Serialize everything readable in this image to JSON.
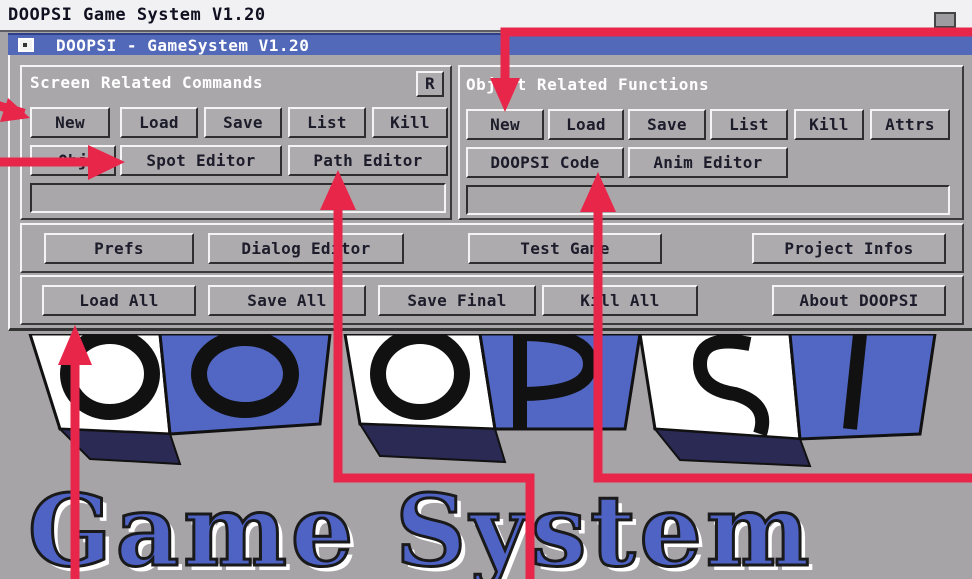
{
  "screen": {
    "title": "DOOPSI Game System V1.20"
  },
  "window": {
    "title": "DOOPSI - GameSystem V1.20"
  },
  "screen_panel": {
    "header": "Screen Related Commands",
    "r_button": "R",
    "row1": [
      "New",
      "Load",
      "Save",
      "List",
      "Kill"
    ],
    "row2": [
      "Obj",
      "Spot Editor",
      "Path Editor"
    ]
  },
  "object_panel": {
    "header": "Object Related Functions",
    "row1": [
      "New",
      "Load",
      "Save",
      "List",
      "Kill",
      "Attrs"
    ],
    "row2": [
      "DOOPSI Code",
      "Anim Editor"
    ]
  },
  "middle_row": [
    "Prefs",
    "Dialog Editor",
    "Test Game",
    "Project Infos"
  ],
  "bottom_row": [
    "Load All",
    "Save All",
    "Save Final",
    "Kill All",
    "About DOOPSI"
  ],
  "logo": {
    "letters": "DOOPSI",
    "subtitle": "Game System"
  },
  "colors": {
    "accent_blue": "#5269ba",
    "annotation_red": "#e8264a",
    "panel_gray": "#aaa7aa"
  }
}
